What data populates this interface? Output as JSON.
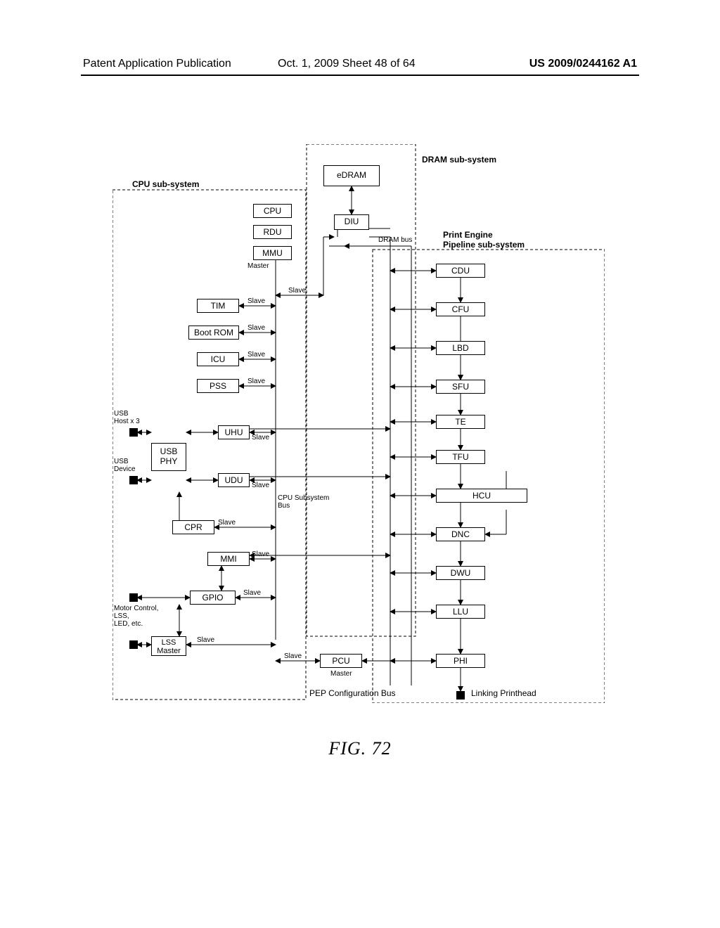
{
  "header": {
    "left": "Patent Application Publication",
    "mid": "Oct. 1, 2009   Sheet 48 of 64",
    "right": "US 2009/0244162 A1"
  },
  "figure": {
    "caption": "FIG. 72"
  },
  "regions": {
    "cpu": "CPU sub-system",
    "dram": "DRAM sub-system",
    "pep": "Print Engine\nPipeline sub-system"
  },
  "cpu_blocks": {
    "cpu": "CPU",
    "rdu": "RDU",
    "mmu": "MMU",
    "tim": "TIM",
    "bootrom": "Boot ROM",
    "icu": "ICU",
    "pss": "PSS",
    "uhu": "UHU",
    "udu": "UDU",
    "usbphy": "USB\nPHY",
    "cpr": "CPR",
    "mmi": "MMI",
    "gpio": "GPIO",
    "lss": "LSS\nMaster",
    "pcu": "PCU"
  },
  "dram_blocks": {
    "edram": "eDRAM",
    "diu": "DIU"
  },
  "pep_blocks": {
    "cdu": "CDU",
    "cfu": "CFU",
    "lbd": "LBD",
    "sfu": "SFU",
    "te": "TE",
    "tfu": "TFU",
    "hcu": "HCU",
    "dnc": "DNC",
    "dwu": "DWU",
    "llu": "LLU",
    "phi": "PHI"
  },
  "labels": {
    "master": "Master",
    "slave": "Slave",
    "usb_host": "USB\nHost x 3",
    "usb_device": "USB\nDevice",
    "motor_etc": "Motor Control,\nLSS,\nLED, etc.",
    "cpu_bus": "CPU Subsystem\nBus",
    "dram_bus": "DRAM bus",
    "pep_bus": "PEP Configuration Bus",
    "linking": "Linking Printhead"
  },
  "chart_data": {
    "type": "block-diagram",
    "title": "FIG. 72",
    "subsystems": [
      {
        "name": "CPU sub-system",
        "blocks": [
          "CPU",
          "RDU",
          "MMU",
          "TIM",
          "Boot ROM",
          "ICU",
          "PSS",
          "UHU",
          "UDU",
          "USB PHY",
          "CPR",
          "MMI",
          "GPIO",
          "LSS Master",
          "PCU"
        ]
      },
      {
        "name": "DRAM sub-system",
        "blocks": [
          "eDRAM",
          "DIU"
        ]
      },
      {
        "name": "Print Engine Pipeline sub-system",
        "blocks": [
          "CDU",
          "CFU",
          "LBD",
          "SFU",
          "TE",
          "TFU",
          "HCU",
          "DNC",
          "DWU",
          "LLU",
          "PHI"
        ]
      }
    ],
    "buses": [
      "CPU Subsystem Bus",
      "DRAM bus",
      "PEP Configuration Bus"
    ],
    "master_slave": {
      "master": [
        "MMU",
        "PCU"
      ],
      "slave": [
        "TIM",
        "Boot ROM",
        "ICU",
        "PSS",
        "UHU",
        "UDU",
        "CPR",
        "MMI",
        "GPIO",
        "LSS Master",
        "PCU",
        "CDU",
        "CFU",
        "LBD",
        "SFU",
        "TE",
        "TFU",
        "HCU",
        "DNC",
        "DWU",
        "LLU",
        "PHI"
      ]
    },
    "external_ports": [
      {
        "name": "USB Host x 3",
        "connects": "UHU"
      },
      {
        "name": "USB Device",
        "connects": "UDU"
      },
      {
        "name": "Motor Control, LSS, LED, etc.",
        "connects": "GPIO"
      },
      {
        "name": "Linking Printhead",
        "connects": "PHI"
      }
    ],
    "pipeline_chain": [
      "CDU",
      "CFU",
      "SFU",
      "TE",
      "TFU",
      "HCU",
      "DNC",
      "DWU",
      "LLU",
      "PHI"
    ],
    "side_inputs": [
      {
        "into": "SFU",
        "from": "LBD"
      },
      {
        "into": "HCU",
        "side": "right"
      },
      {
        "into": "DNC",
        "side": "right"
      }
    ]
  }
}
